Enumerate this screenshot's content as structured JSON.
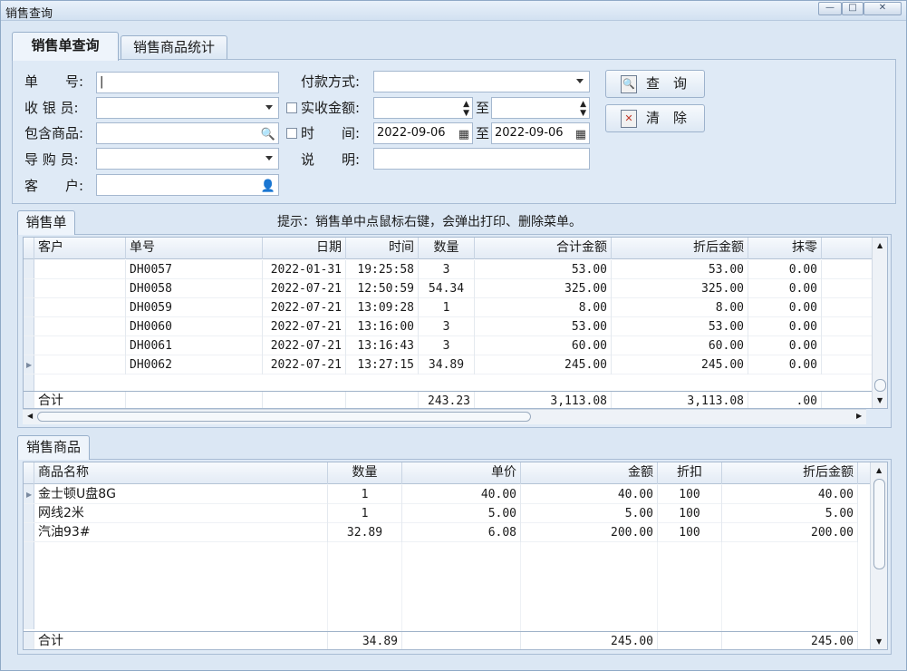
{
  "window": {
    "title": "销售查询",
    "min_label": "—",
    "max_label": "□",
    "close_label": "✕"
  },
  "tabs": [
    {
      "label": "销售单查询"
    },
    {
      "label": "销售商品统计"
    }
  ],
  "form": {
    "order_no_label": "单　　号:",
    "cashier_label": "收 银 员:",
    "product_label": "包含商品:",
    "guide_label": "导 购 员:",
    "customer_label": "客　　户:",
    "payment_label": "付款方式:",
    "amount_label": "实收金额:",
    "amount_to": "至",
    "time_label": "时　　间:",
    "date_from": "2022-09-06",
    "date_to_label": "至",
    "date_to": "2022-09-06",
    "note_label": "说　　明:",
    "order_no_value": "|"
  },
  "buttons": {
    "query": "查　询",
    "clear": "清　除"
  },
  "orders": {
    "tab": "销售单",
    "hint": "提示：销售单中点鼠标右键，会弹出打印、删除菜单。",
    "columns": [
      "客户",
      "单号",
      "日期",
      "时间",
      "数量",
      "合计金额",
      "折后金额",
      "抹零"
    ],
    "rows": [
      {
        "customer": "",
        "no": "DH0057",
        "date": "2022-01-31",
        "time": "19:25:58",
        "qty": "3",
        "total": "53.00",
        "discounted": "53.00",
        "round": "0.00"
      },
      {
        "customer": "",
        "no": "DH0058",
        "date": "2022-07-21",
        "time": "12:50:59",
        "qty": "54.34",
        "total": "325.00",
        "discounted": "325.00",
        "round": "0.00"
      },
      {
        "customer": "",
        "no": "DH0059",
        "date": "2022-07-21",
        "time": "13:09:28",
        "qty": "1",
        "total": "8.00",
        "discounted": "8.00",
        "round": "0.00"
      },
      {
        "customer": "",
        "no": "DH0060",
        "date": "2022-07-21",
        "time": "13:16:00",
        "qty": "3",
        "total": "53.00",
        "discounted": "53.00",
        "round": "0.00"
      },
      {
        "customer": "",
        "no": "DH0061",
        "date": "2022-07-21",
        "time": "13:16:43",
        "qty": "3",
        "total": "60.00",
        "discounted": "60.00",
        "round": "0.00"
      },
      {
        "customer": "",
        "no": "DH0062",
        "date": "2022-07-21",
        "time": "13:27:15",
        "qty": "34.89",
        "total": "245.00",
        "discounted": "245.00",
        "round": "0.00"
      }
    ],
    "footer": {
      "label": "合计",
      "qty": "243.23",
      "total": "3,113.08",
      "discounted": "3,113.08",
      "round": ".00"
    }
  },
  "items": {
    "tab": "销售商品",
    "columns": [
      "商品名称",
      "数量",
      "单价",
      "金额",
      "折扣",
      "折后金额"
    ],
    "rows": [
      {
        "name": "金士顿U盘8G",
        "qty": "1",
        "price": "40.00",
        "amount": "40.00",
        "discount": "100",
        "discounted": "40.00"
      },
      {
        "name": "网线2米",
        "qty": "1",
        "price": "5.00",
        "amount": "5.00",
        "discount": "100",
        "discounted": "5.00"
      },
      {
        "name": "汽油93#",
        "qty": "32.89",
        "price": "6.08",
        "amount": "200.00",
        "discount": "100",
        "discounted": "200.00"
      }
    ],
    "footer": {
      "label": "合计",
      "qty": "34.89",
      "amount": "245.00",
      "discounted": "245.00"
    }
  }
}
